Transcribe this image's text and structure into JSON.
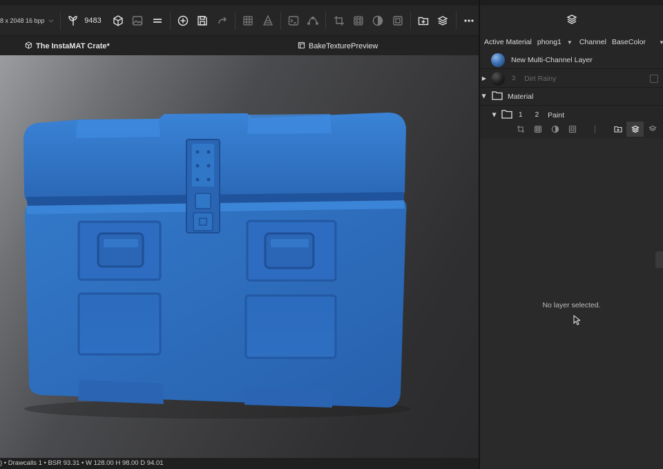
{
  "toolbar": {
    "resolution": "8 x 2048 16 bpp",
    "count": "9483",
    "icons": [
      "seedling-icon",
      "cube-icon",
      "image-icon",
      "equals-icon",
      "add-circle-icon",
      "save-icon",
      "redo-icon",
      "grid-icon",
      "pyramid-icon",
      "terminal-icon",
      "curve-icon",
      "crop-icon",
      "pattern-icon",
      "contrast-icon",
      "image-frame-icon",
      "add-folder-icon",
      "layers-add-icon",
      "more-icon"
    ]
  },
  "tabs": [
    {
      "label": "The InstaMAT Crate*",
      "icon": "cube-icon"
    },
    {
      "label": "BakeTexturePreview",
      "icon": "image-frame-icon"
    }
  ],
  "statusbar": {
    "text": ") • Drawcalls 1 • BSR 93.31 • W 128.00 H 98.00 D 94.01"
  },
  "panel": {
    "active_material_label": "Active Material",
    "active_material_value": "phong1",
    "channel_label": "Channel",
    "channel_value": "BaseColor",
    "layers": [
      {
        "name": "New Multi-Channel Layer",
        "thumb": "blue-sphere"
      },
      {
        "name": "Dirt Rainy",
        "badge": "3"
      },
      {
        "name": "Material",
        "type": "folder"
      },
      {
        "name": "Paint",
        "badges": [
          "1",
          "2"
        ]
      }
    ],
    "empty_message": "No layer selected."
  },
  "colors": {
    "crate_blue": "#2f6fc0",
    "accent": "#3c3c3c"
  }
}
